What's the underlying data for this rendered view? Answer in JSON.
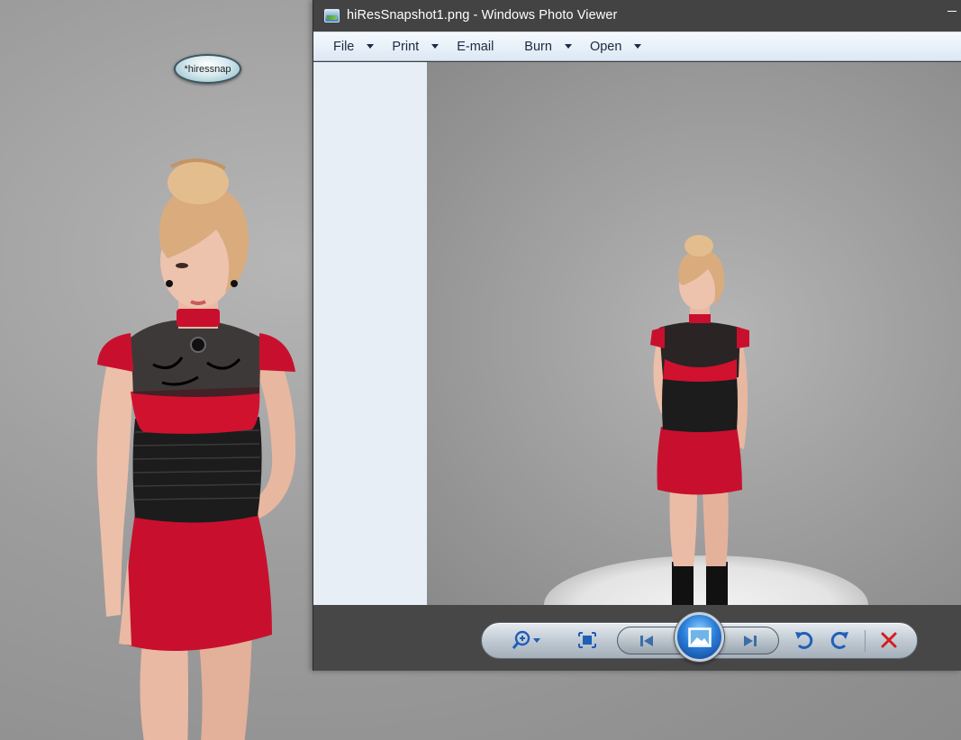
{
  "scene": {
    "snap_button_label": "*hiressnap"
  },
  "window": {
    "title": "hiResSnapshot1.png - Windows Photo Viewer"
  },
  "menu": [
    {
      "label": "File",
      "has_dropdown": true
    },
    {
      "label": "Print",
      "has_dropdown": true
    },
    {
      "label": "E-mail",
      "has_dropdown": false
    },
    {
      "label": "Burn",
      "has_dropdown": true
    },
    {
      "label": "Open",
      "has_dropdown": true
    }
  ],
  "controls": {
    "zoom": "zoom-icon",
    "actual_size": "fit-to-window-icon",
    "previous": "previous-icon",
    "slideshow": "slideshow-icon",
    "next": "next-icon",
    "rotate_ccw": "rotate-counterclockwise-icon",
    "rotate_cw": "rotate-clockwise-icon",
    "delete": "delete-icon"
  },
  "colors": {
    "titlebar": "#434343",
    "menubar": "#e4edf6",
    "controlbar": "#474747",
    "accent_blue": "#2a7ed8",
    "delete_red": "#d21e1e",
    "dress_red": "#c8102e"
  }
}
